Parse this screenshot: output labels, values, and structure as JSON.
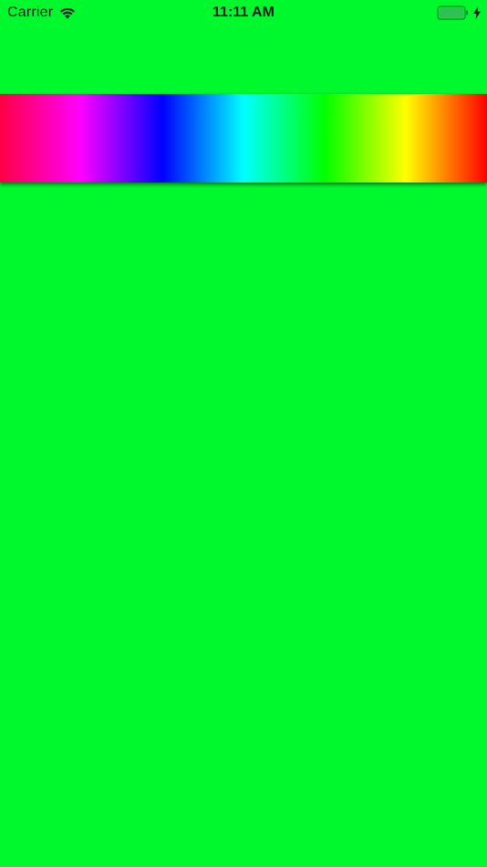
{
  "status_bar": {
    "carrier": "Carrier",
    "time": "11:11 AM",
    "icons": {
      "wifi": "wifi-icon",
      "battery": "battery-icon",
      "charging": "bolt-icon"
    },
    "battery_level_fraction": 1.0
  },
  "colors": {
    "background": "#00F92D",
    "battery_fill": "#2fc152",
    "spectrum_stops": [
      "#FF0044",
      "#FF00FF",
      "#0000FF",
      "#00FFFF",
      "#00FF00",
      "#FFFF00",
      "#FF0000"
    ]
  },
  "spectrum_bar": {
    "name": "hue-spectrum"
  }
}
